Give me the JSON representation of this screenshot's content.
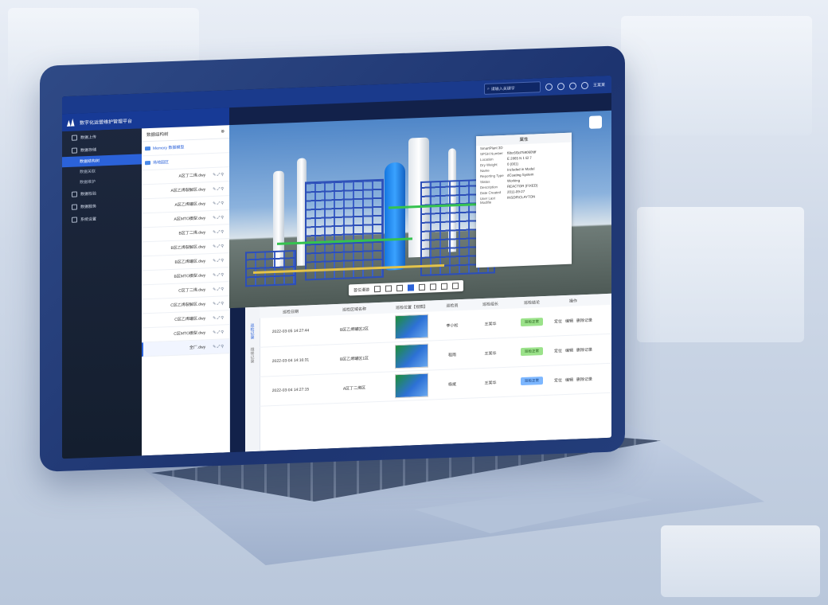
{
  "app": {
    "title": "数字化运营维护管理平台"
  },
  "topbar": {
    "search_placeholder": "请输入关键字",
    "user": "王某某"
  },
  "sidebar": {
    "items": [
      {
        "label": "数据上传"
      },
      {
        "label": "数据存储"
      },
      {
        "label": "数据结构树"
      },
      {
        "label": "数据关联"
      },
      {
        "label": "数据维护"
      },
      {
        "label": "数据检验"
      },
      {
        "label": "数据服务"
      },
      {
        "label": "系统设置"
      }
    ]
  },
  "tree": {
    "title": "数据结构树",
    "groups": [
      {
        "label": "Memory 数据模型"
      },
      {
        "label": "场地园区"
      }
    ],
    "files": [
      "A区丁二烯.dwy",
      "A区乙烯裂解区.dwy",
      "A区乙烯罐区.dwy",
      "A区MTO模型.dwy",
      "B区丁二烯.dwy",
      "B区乙烯裂解区.dwy",
      "B区乙烯罐区.dwy",
      "B区MTO模型.dwy",
      "C区丁二烯.dwy",
      "C区乙烯裂解区.dwy",
      "C区乙烯罐区.dwy",
      "C区MTO模型.dwy",
      "全厂.dwy"
    ]
  },
  "viewer": {
    "toolbar_label": "首位漫游"
  },
  "properties": {
    "title": "属性",
    "section": "SmartPlant 3D",
    "rows": [
      {
        "k": "SPSH Number",
        "v": "f8bc6f3d759060fdf"
      },
      {
        "k": "Location",
        "v": "E 2865 N 1 El 7"
      },
      {
        "k": "Dry Weight",
        "v": "0 (001)"
      },
      {
        "k": "Name",
        "v": "Included in Model"
      },
      {
        "k": "Reporting Type",
        "v": "dCoating System"
      },
      {
        "k": "Status",
        "v": "Working"
      },
      {
        "k": "Description",
        "v": "REACTOR (FIXED)"
      },
      {
        "k": "Date Created",
        "v": "2011-09-27"
      },
      {
        "k": "User Last Modifie",
        "v": "INSDR\\CLAYTON"
      }
    ]
  },
  "table": {
    "side_tabs": [
      "巡检记录",
      "维修记录"
    ],
    "headers": [
      "巡检日期",
      "巡检区域名称",
      "巡检位置【视图】",
      "巡检员",
      "巡检组长",
      "巡检结论",
      "操作"
    ],
    "rows": [
      {
        "date": "2022-03-05 14:27:44",
        "area": "B区乙烯罐区2区",
        "inspector": "李小松",
        "leader": "王某华",
        "result": "巡检正常",
        "ops": [
          "定位",
          "编辑",
          "删除记录"
        ]
      },
      {
        "date": "2022-03-04 14:16:31",
        "area": "B区乙烯罐区1区",
        "inspector": "程雨",
        "leader": "王某华",
        "result": "巡检正常",
        "ops": [
          "定位",
          "编辑",
          "删除记录"
        ]
      },
      {
        "date": "2022-03-04 14:27:15",
        "area": "A区丁二烯区",
        "inspector": "杨斌",
        "leader": "王某华",
        "result": "巡检正常",
        "ops": [
          "定位",
          "编辑",
          "删除记录"
        ]
      }
    ]
  }
}
